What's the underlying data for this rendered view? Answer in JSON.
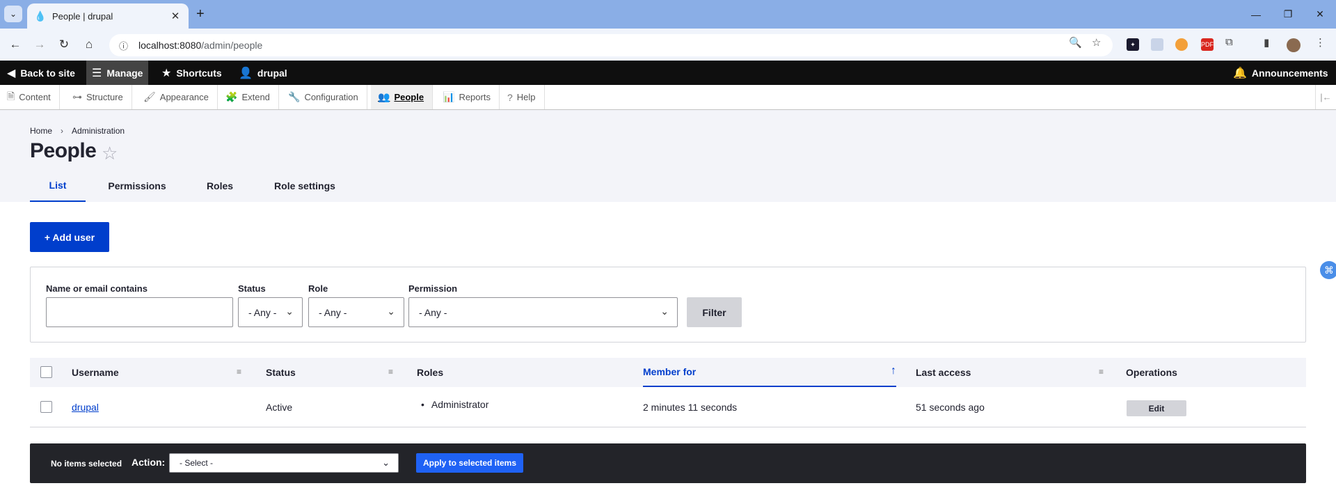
{
  "browser": {
    "tab_title": "People | drupal",
    "tab_close": "✕",
    "new_tab": "+",
    "url_host": "localhost:8080",
    "url_path": "/admin/people",
    "window": {
      "minimize": "—",
      "restore": "❐",
      "close": "✕"
    },
    "extensions": [
      "puzzle-icon",
      "pdf-icon",
      "sidebar-icon"
    ],
    "pdf_badge": "PDF"
  },
  "drupal_toolbar": {
    "back_to_site": "Back to site",
    "manage": "Manage",
    "shortcuts": "Shortcuts",
    "user": "drupal",
    "announcements": "Announcements"
  },
  "admin_menu": [
    {
      "label": "Content",
      "icon": "document-icon"
    },
    {
      "label": "Structure",
      "icon": "sitemap-icon"
    },
    {
      "label": "Appearance",
      "icon": "paintbrush-icon"
    },
    {
      "label": "Extend",
      "icon": "puzzle-icon"
    },
    {
      "label": "Configuration",
      "icon": "wrench-icon"
    },
    {
      "label": "People",
      "icon": "people-icon"
    },
    {
      "label": "Reports",
      "icon": "bar-chart-icon"
    },
    {
      "label": "Help",
      "icon": "help-icon"
    }
  ],
  "breadcrumb": {
    "home": "Home",
    "separator": "›",
    "administration": "Administration"
  },
  "page": {
    "title": "People",
    "star": "☆",
    "tabs": [
      "List",
      "Permissions",
      "Roles",
      "Role settings"
    ]
  },
  "add_user_button": "+ Add user",
  "filters": {
    "name_label": "Name or email contains",
    "name_value": "",
    "status_label": "Status",
    "status_value": "- Any -",
    "role_label": "Role",
    "role_value": "- Any -",
    "permission_label": "Permission",
    "permission_value": "- Any -",
    "filter_button": "Filter"
  },
  "table": {
    "columns": [
      "Username",
      "Status",
      "Roles",
      "Member for",
      "Last access",
      "Operations"
    ],
    "sorted_column": "Member for",
    "rows": [
      {
        "username": "drupal",
        "status": "Active",
        "roles": [
          "Administrator"
        ],
        "member_for": "2 minutes 11 seconds",
        "last_access": "51 seconds ago",
        "operation": "Edit"
      }
    ]
  },
  "bulk_actions": {
    "selection_status": "No items selected",
    "action_label": "Action:",
    "action_value": "- Select -",
    "apply_button": "Apply to selected items"
  },
  "colors": {
    "primary": "#003ecc",
    "toolbar_dark": "#0f0f0f",
    "bulk_bar": "#232429",
    "header_bg": "#f3f4f9"
  }
}
